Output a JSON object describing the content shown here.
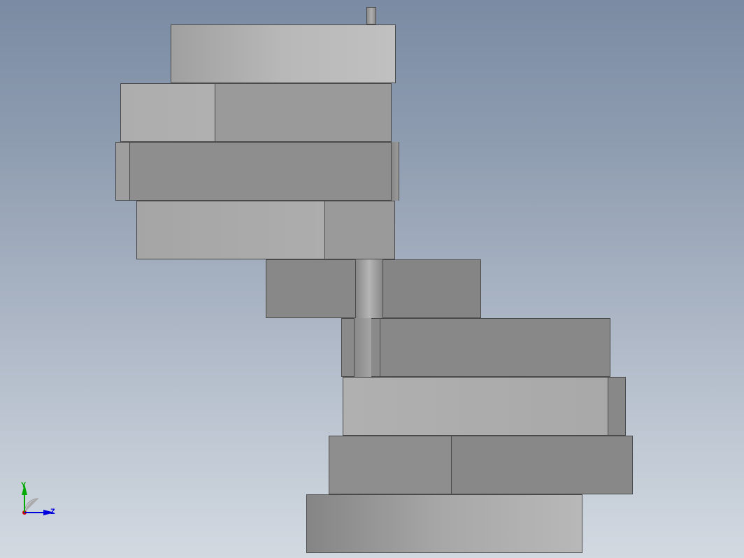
{
  "axes": {
    "y_label": "Y",
    "z_label": "Z"
  },
  "model": {
    "description": "Spiral staircase 3D CAD model side view",
    "steps_count": 9,
    "view": "side-orthographic"
  }
}
